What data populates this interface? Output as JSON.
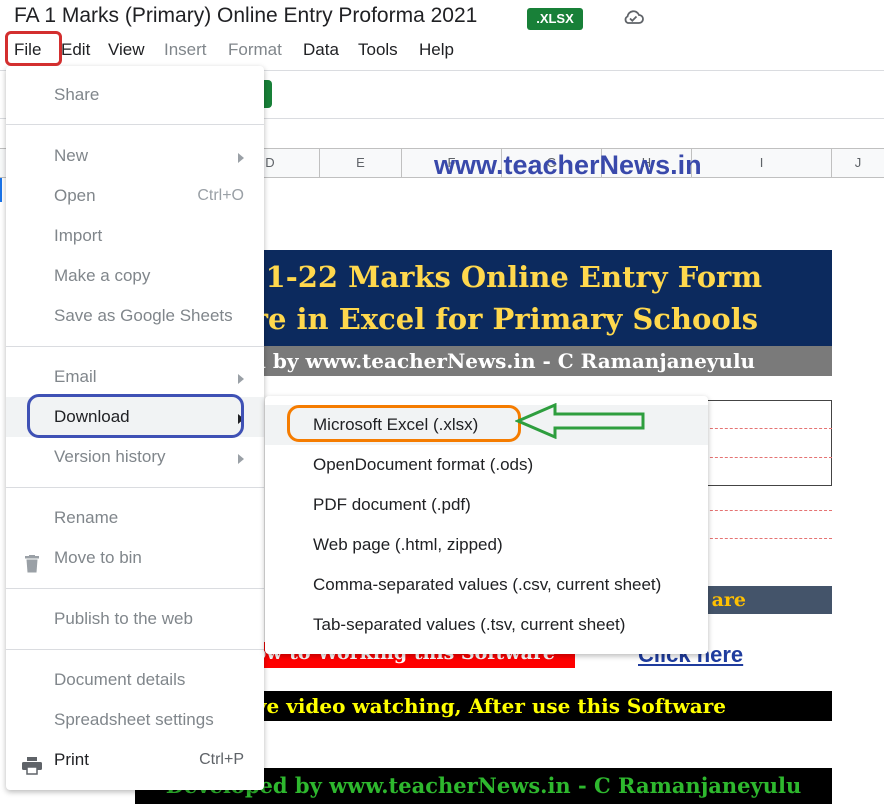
{
  "header": {
    "title": "FA 1 Marks (Primary)  Online Entry Proforma 2021",
    "badge": ".XLSX",
    "cloud_icon": "cloud-check-icon"
  },
  "menubar": {
    "items": [
      "File",
      "Edit",
      "View",
      "Insert",
      "Format",
      "Data",
      "Tools",
      "Help"
    ]
  },
  "sheet": {
    "column_headers": [
      "D",
      "E",
      "F",
      "G",
      "H",
      "I",
      "J"
    ],
    "watermark": "www.teacherNews.in",
    "banner_line1": "2021-22 Marks Online Entry Form",
    "banner_line2": "ware in Excel for Primary Schools",
    "developer_line": "oped by www.teacherNews.in - C Ramanjaneyulu",
    "software_label": "are",
    "video_label": "ow to Working this Software",
    "click_here": "Click here",
    "instruction": "bove video watching, After use this Software",
    "footer": "Developed by www.teacherNews.in - C Ramanjaneyulu"
  },
  "file_menu": {
    "share": "Share",
    "new": "New",
    "open": "Open",
    "open_shortcut": "Ctrl+O",
    "import": "Import",
    "make_copy": "Make a copy",
    "save_as_sheets": "Save as Google Sheets",
    "email": "Email",
    "download": "Download",
    "version_history": "Version history",
    "rename": "Rename",
    "move_to_bin": "Move to bin",
    "publish": "Publish to the web",
    "document_details": "Document details",
    "spreadsheet_settings": "Spreadsheet settings",
    "print": "Print",
    "print_shortcut": "Ctrl+P",
    "bin_icon": "trash-icon",
    "print_icon": "printer-icon"
  },
  "download_menu": {
    "items": [
      "Microsoft Excel (.xlsx)",
      "OpenDocument format (.ods)",
      "PDF document (.pdf)",
      "Web page (.html, zipped)",
      "Comma-separated values (.csv, current sheet)",
      "Tab-separated values (.tsv, current sheet)"
    ]
  },
  "annotations": {
    "highlight_red": "#d32f2f",
    "highlight_blue": "#3f51b5",
    "highlight_orange": "#f57c00",
    "arrow_green": "#2e9e3e"
  }
}
